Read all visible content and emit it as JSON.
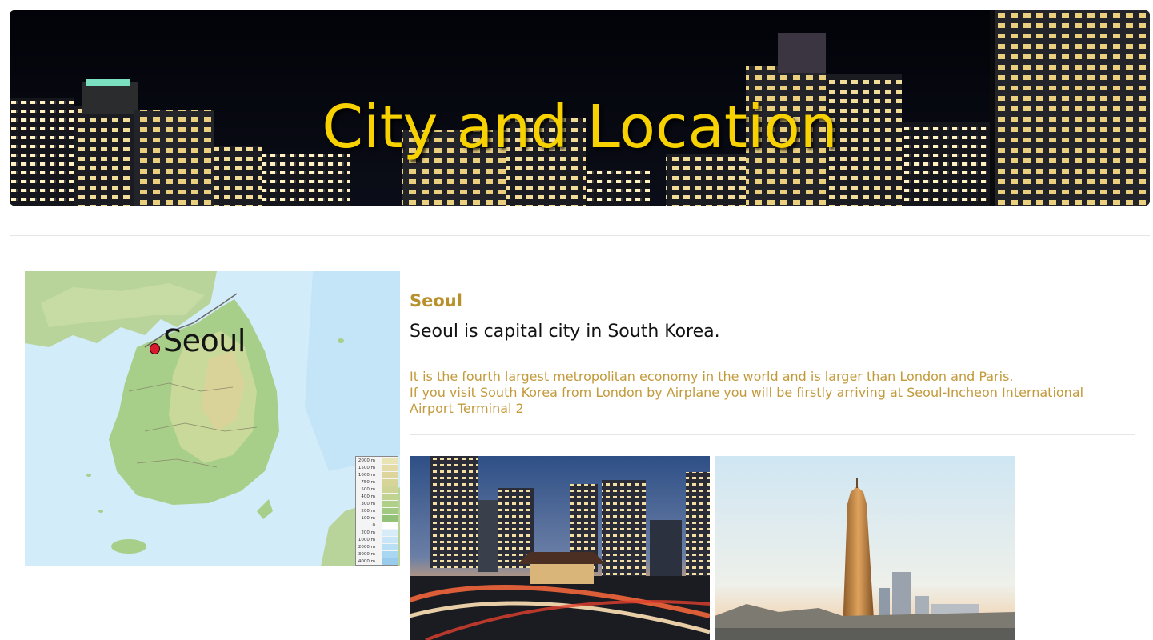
{
  "banner": {
    "title": "City and Location",
    "title_color": "#f7d200"
  },
  "map": {
    "city_label": "Seoul",
    "legend": [
      "2000 m",
      "1500 m",
      "1000 m",
      "750 m",
      "500 m",
      "400 m",
      "300 m",
      "200 m",
      "100 m",
      "0",
      "200 m",
      "1000 m",
      "2000 m",
      "3000 m",
      "4000 m"
    ]
  },
  "city": {
    "name": "Seoul",
    "lead": "Seoul is capital city in South Korea.",
    "description_lines": [
      "It is the fourth largest metropolitan economy in the world and is larger than London and Paris.",
      "If you visit South Korea from London by Airplane you will be firstly arriving at Seoul-Incheon International",
      "Airport Terminal 2"
    ],
    "name_color": "#b8912c",
    "description_color": "#c39a3b"
  },
  "photos": [
    "namdaemun-gate-night-photo",
    "63-building-river-photo"
  ]
}
